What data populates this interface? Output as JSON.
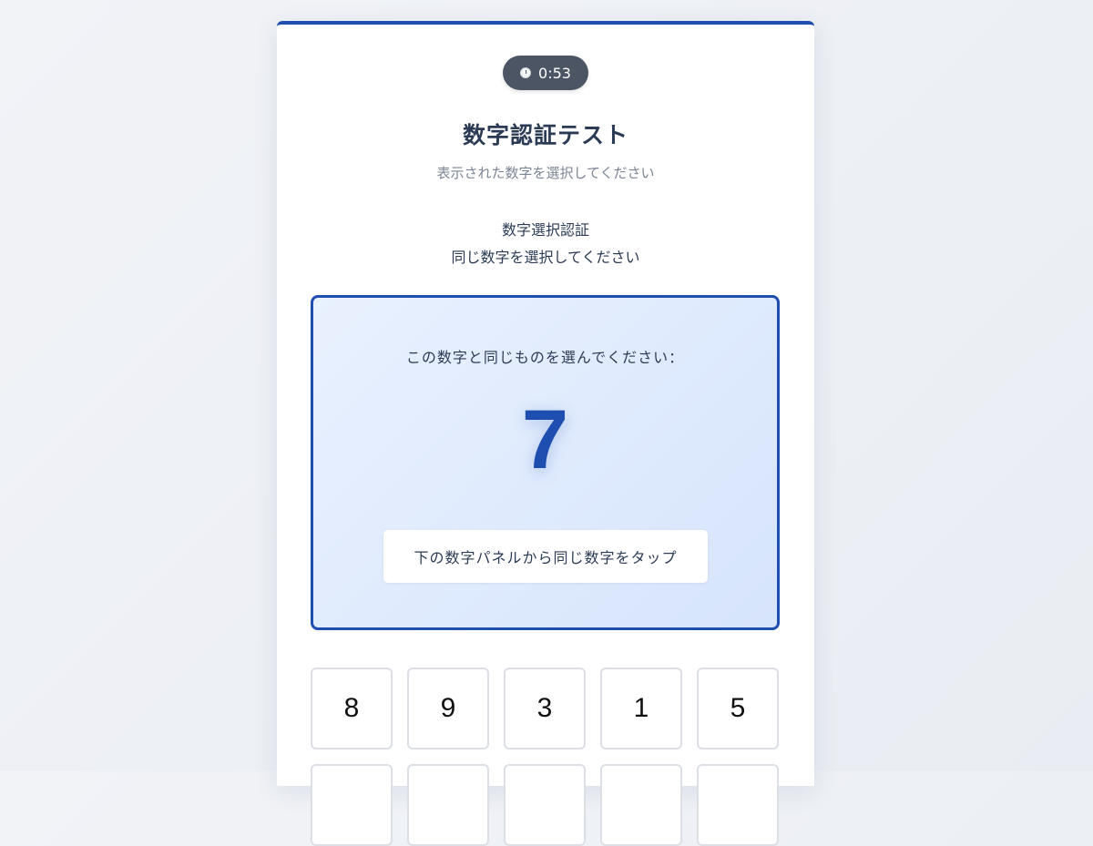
{
  "timer": {
    "icon": "stopwatch-icon",
    "value": "0:53"
  },
  "header": {
    "title": "数字認証テスト",
    "subtitle": "表示された数字を選択してください"
  },
  "instructions": {
    "line1": "数字選択認証",
    "line2": "同じ数字を選択してください"
  },
  "target": {
    "prompt": "この数字と同じものを選んでください：",
    "digit": "7",
    "hint": "下の数字パネルから同じ数字をタップ"
  },
  "tiles_row1": [
    "8",
    "9",
    "3",
    "1",
    "5"
  ],
  "colors": {
    "accent": "#1e4fb0",
    "target_bg": "#dbe7fd",
    "timer_bg": "#4b5563",
    "title": "#2b3a55"
  }
}
